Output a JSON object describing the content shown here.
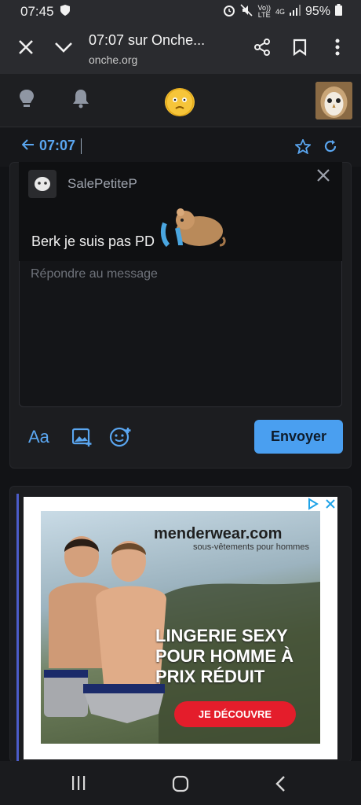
{
  "status_bar": {
    "time": "07:45",
    "network_top": "Vo))",
    "network_bottom": "LTE",
    "data_top": "4G",
    "battery": "95%"
  },
  "browser": {
    "title": "07:07 sur Onche...",
    "url": "onche.org"
  },
  "page": {
    "nav_label": "07:07"
  },
  "quote": {
    "username": "SalePetiteP",
    "text": "Berk je suis pas PD"
  },
  "reply": {
    "placeholder": "Répondre au message",
    "font_label": "Aa",
    "send_label": "Envoyer"
  },
  "ad": {
    "brand": "menderwear.com",
    "brand_sub": "sous-vêtements pour hommes",
    "headline": "LINGERIE SEXY POUR HOMME À PRIX RÉDUIT",
    "cta": "JE DÉCOUVRE"
  },
  "colors": {
    "accent": "#4a9ff0",
    "ad_cta": "#e41d2b",
    "logo": "#f6c53a"
  },
  "icons": [
    "close-icon",
    "chevron-down-icon",
    "share-icon",
    "bookmark-icon",
    "more-vert-icon",
    "lightbulb-icon",
    "bell-icon",
    "star-icon",
    "refresh-icon",
    "arrow-left-icon",
    "image-add-icon",
    "emoji-add-icon",
    "ad-choices-icon",
    "recent-apps-icon",
    "home-icon",
    "back-icon"
  ]
}
